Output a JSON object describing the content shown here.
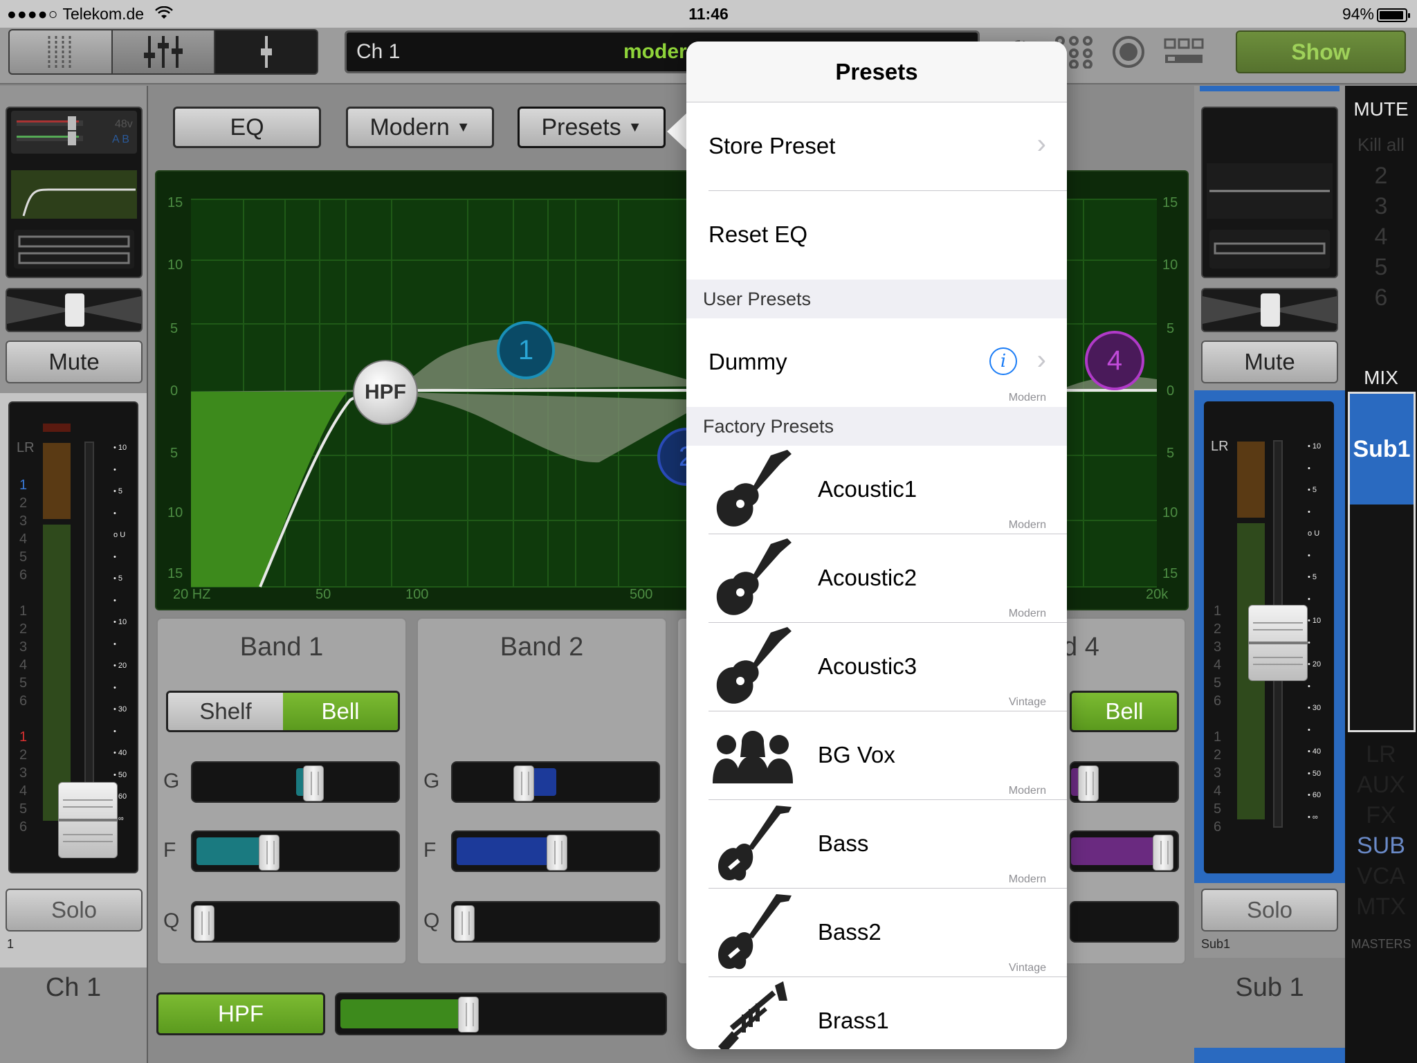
{
  "status": {
    "carrier": "Telekom.de",
    "time": "11:46",
    "battery": "94%"
  },
  "topbar": {
    "channel_name": "Ch 1",
    "channel_mode": "moder",
    "eq_tag": "EQ",
    "show_label": "Show"
  },
  "left_strip": {
    "display_labels": [
      "48v",
      "A B"
    ],
    "mute": "Mute",
    "solo": "Solo",
    "channel_number": "1",
    "channel_label": "Ch 1",
    "lr": "LR",
    "scale_groups": [
      [
        "1",
        "2",
        "3",
        "4",
        "5",
        "6"
      ],
      [
        "1",
        "2",
        "3",
        "4",
        "5",
        "6"
      ],
      [
        "1",
        "2",
        "3",
        "4",
        "5",
        "6"
      ]
    ],
    "ticks": [
      "10",
      "5",
      "U",
      "5",
      "10",
      "20",
      "30",
      "40",
      "50",
      "60",
      "∞"
    ]
  },
  "eq_buttons": {
    "eq": "EQ",
    "mode": "Modern",
    "presets": "Presets"
  },
  "graph": {
    "y_labels": [
      "15",
      "10",
      "5",
      "0",
      "5",
      "10",
      "15"
    ],
    "x_labels": [
      "20 HZ",
      "50",
      "100",
      "500",
      "20k"
    ],
    "nodes": {
      "hpf": "HPF",
      "n1": "1",
      "n2": "2",
      "n4": "4"
    }
  },
  "bands": [
    {
      "title": "Band 1",
      "type_left": "Shelf",
      "type_right": "Bell",
      "g": "G",
      "f": "F",
      "q": "Q"
    },
    {
      "title": "Band 2",
      "g": "G",
      "f": "F",
      "q": "Q"
    },
    {
      "title": "d 4",
      "type_right": "Bell"
    }
  ],
  "hpf": {
    "label": "HPF"
  },
  "right_strip": {
    "mute": "Mute",
    "solo": "Solo",
    "lr": "LR",
    "channel_number": "Sub1",
    "channel_label": "Sub 1"
  },
  "master_col": {
    "mute_title": "MUTE",
    "kill_all": "Kill all",
    "groups": [
      "2",
      "3",
      "4",
      "5",
      "6"
    ],
    "mix_title": "MIX",
    "active": "Sub1",
    "list": [
      "LR",
      "AUX",
      "FX",
      "SUB",
      "VCA",
      "MTX"
    ],
    "masters": "MASTERS"
  },
  "popover": {
    "title": "Presets",
    "store": "Store Preset",
    "reset": "Reset EQ",
    "user_header": "User Presets",
    "user": [
      {
        "name": "Dummy",
        "style": "Modern"
      }
    ],
    "factory_header": "Factory Presets",
    "factory": [
      {
        "name": "Acoustic1",
        "style": "Modern",
        "icon": "acoustic-guitar-icon"
      },
      {
        "name": "Acoustic2",
        "style": "Modern",
        "icon": "acoustic-guitar-icon"
      },
      {
        "name": "Acoustic3",
        "style": "Vintage",
        "icon": "acoustic-guitar-icon"
      },
      {
        "name": "BG Vox",
        "style": "Modern",
        "icon": "singers-icon"
      },
      {
        "name": "Bass",
        "style": "Modern",
        "icon": "bass-guitar-icon"
      },
      {
        "name": "Bass2",
        "style": "Vintage",
        "icon": "bass-guitar-icon"
      },
      {
        "name": "Brass1",
        "style": "",
        "icon": "trumpet-icon"
      }
    ]
  }
}
